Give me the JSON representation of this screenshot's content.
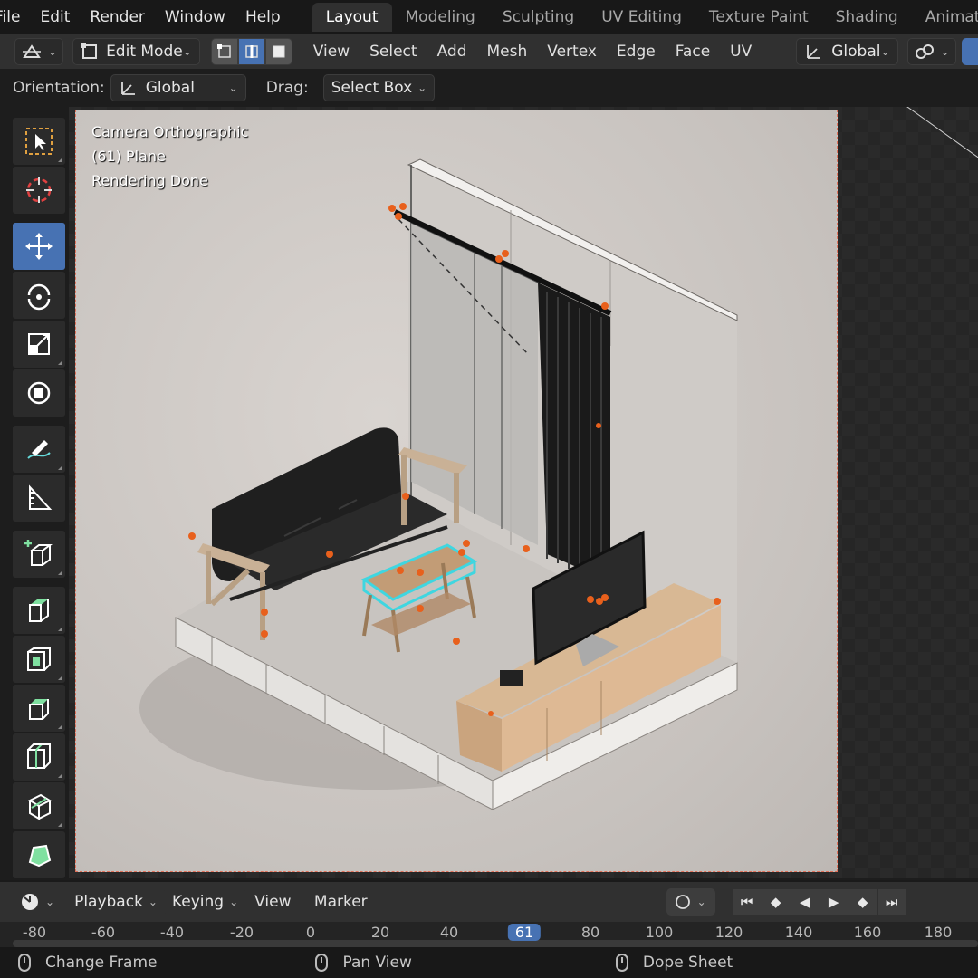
{
  "menu": [
    "File",
    "Edit",
    "Render",
    "Window",
    "Help"
  ],
  "workspaces": [
    "Layout",
    "Modeling",
    "Sculpting",
    "UV Editing",
    "Texture Paint",
    "Shading",
    "Animation"
  ],
  "active_workspace": "Layout",
  "header": {
    "mode": "Edit Mode",
    "menus": [
      "View",
      "Select",
      "Add",
      "Mesh",
      "Vertex",
      "Edge",
      "Face",
      "UV"
    ],
    "transform_orientation": "Global"
  },
  "tool_settings": {
    "orientation_label": "Orientation:",
    "orientation_value": "Global",
    "drag_label": "Drag:",
    "drag_value": "Select Box"
  },
  "toolbar": [
    {
      "name": "select-box-icon"
    },
    {
      "name": "cursor-icon"
    },
    {
      "name": "move-icon",
      "active": true
    },
    {
      "name": "rotate-icon"
    },
    {
      "name": "scale-icon"
    },
    {
      "name": "transform-icon"
    },
    {
      "name": "annotate-icon"
    },
    {
      "name": "measure-icon"
    },
    {
      "name": "add-cube-icon"
    },
    {
      "name": "extrude-icon"
    },
    {
      "name": "inset-icon"
    },
    {
      "name": "bevel-icon"
    },
    {
      "name": "loop-cut-icon"
    },
    {
      "name": "knife-icon"
    },
    {
      "name": "poly-build-icon"
    }
  ],
  "viewport_overlay": [
    "Camera Orthographic",
    "(61) Plane",
    "Rendering Done"
  ],
  "timeline": {
    "menus": [
      "Playback",
      "Keying",
      "View",
      "Marker"
    ],
    "frames": [
      "-80",
      "-60",
      "-40",
      "-20",
      "0",
      "20",
      "40",
      "61",
      "80",
      "100",
      "120",
      "140",
      "160",
      "180"
    ],
    "current_frame": "61"
  },
  "status": [
    "Change Frame",
    "Pan View",
    "Dope Sheet"
  ],
  "colors": {
    "accent": "#4772b3",
    "selection": "#3fd6e0",
    "vertex": "#e8601c",
    "camera_frame": "#e0715a"
  }
}
